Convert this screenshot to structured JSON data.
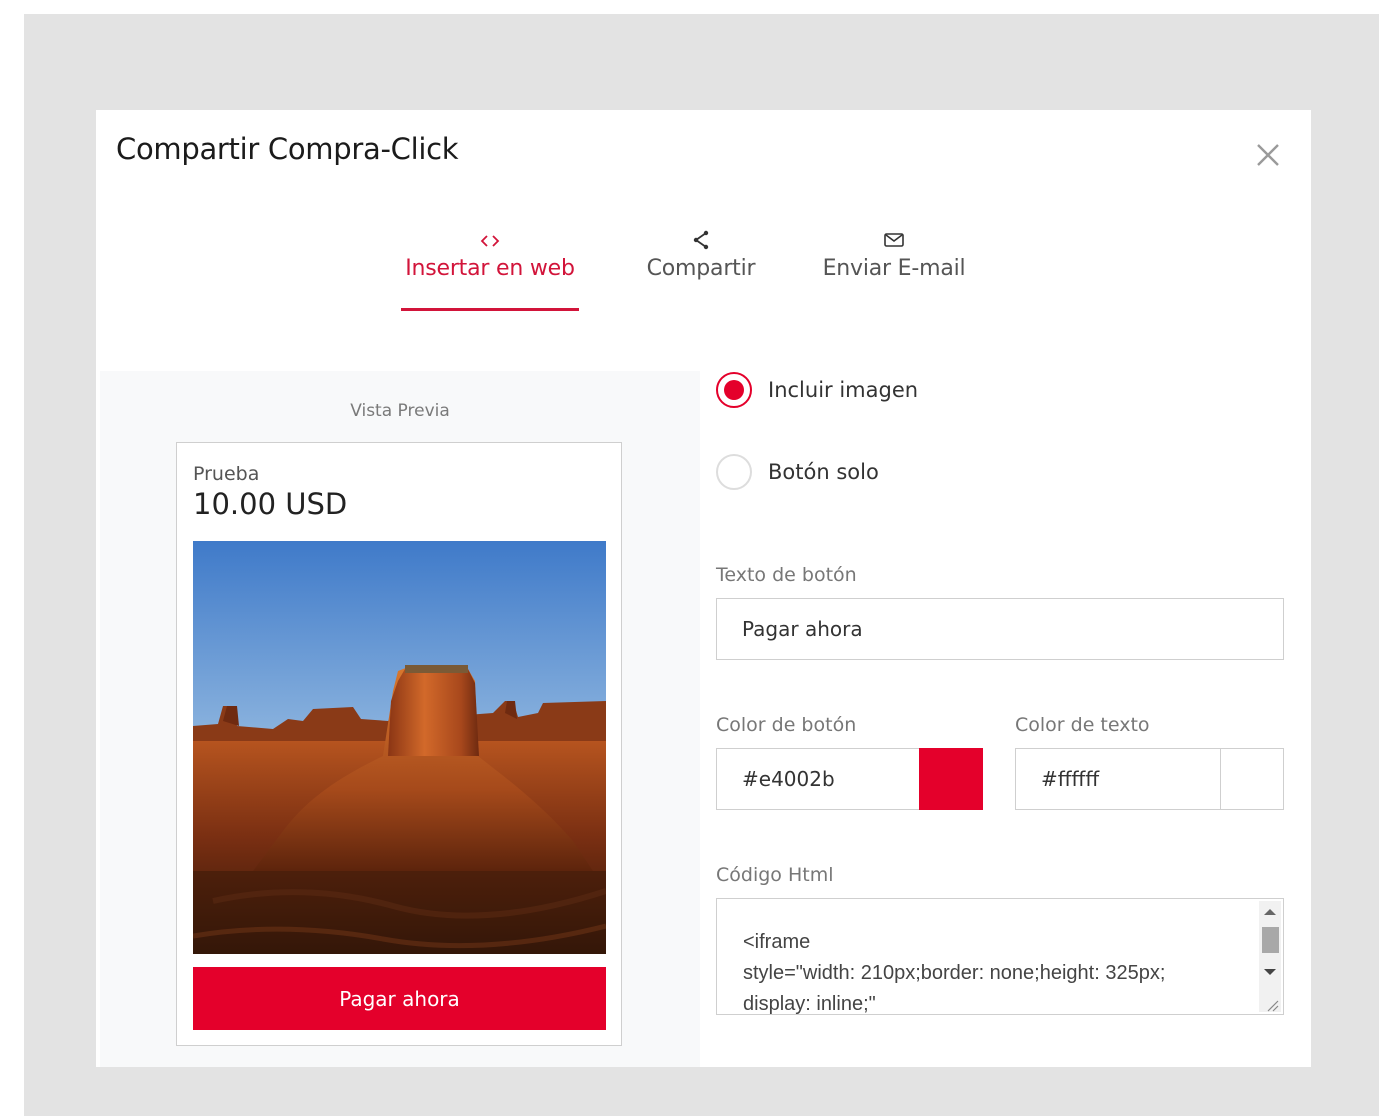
{
  "dialog": {
    "title": "Compartir Compra-Click",
    "close_icon": "close-icon"
  },
  "tabs": [
    {
      "label": "Insertar en web",
      "icon": "code-icon",
      "active": true
    },
    {
      "label": "Compartir",
      "icon": "share-icon",
      "active": false
    },
    {
      "label": "Enviar E-mail",
      "icon": "envelope-icon",
      "active": false
    }
  ],
  "preview": {
    "label": "Vista Previa",
    "product_name": "Prueba",
    "price": "10.00 USD",
    "image_icon": "desert-landscape-image",
    "button_label": "Pagar ahora"
  },
  "options": {
    "include_image": {
      "label": "Incluir imagen",
      "checked": true
    },
    "button_only": {
      "label": "Botón solo",
      "checked": false
    }
  },
  "form": {
    "button_text": {
      "label": "Texto de botón",
      "value": "Pagar ahora"
    },
    "button_color": {
      "label": "Color de botón",
      "value": "#e4002b"
    },
    "text_color": {
      "label": "Color de texto",
      "value": "#ffffff"
    },
    "html_code": {
      "label": "Código Html",
      "value": "<iframe\nstyle=\"width: 210px;border: none;height: 325px;\ndisplay: inline;\""
    }
  },
  "colors": {
    "accent": "#e4002b",
    "tab_active": "#d2143a",
    "backdrop": "#e3e3e3",
    "preview_bg": "#f8f9fa"
  }
}
